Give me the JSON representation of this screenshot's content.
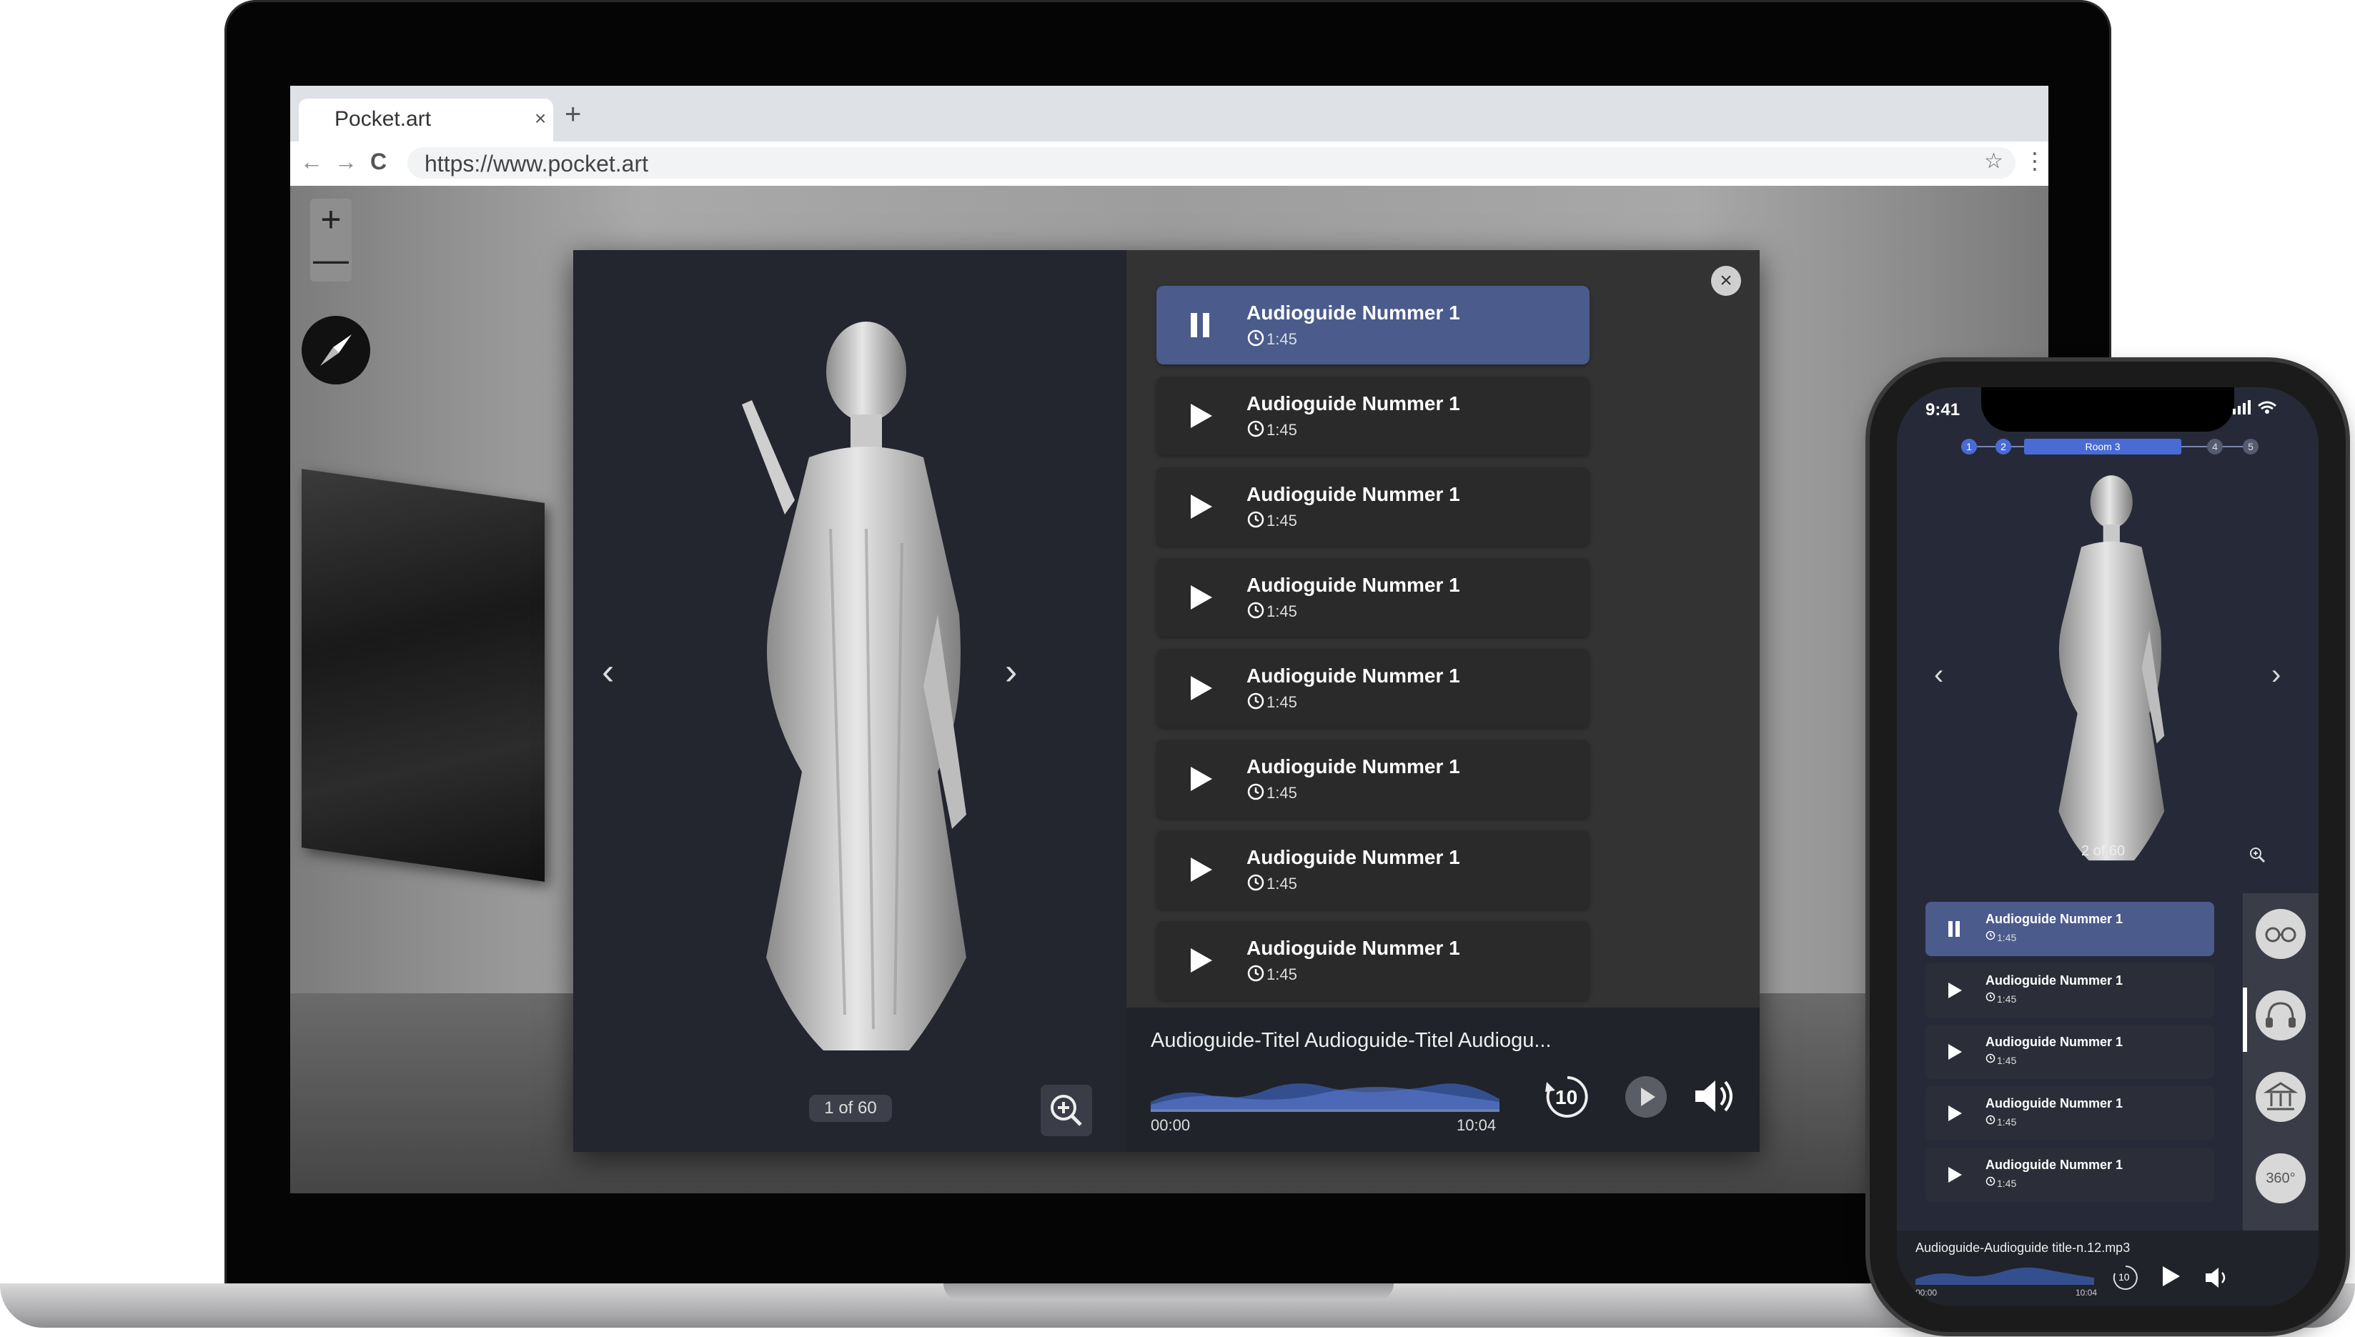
{
  "browser": {
    "tab_title": "Pocket.art",
    "tab_close": "×",
    "new_tab": "+",
    "url": "https://www.pocket.art",
    "back": "←",
    "forward": "→",
    "reload": "C",
    "star": "☆",
    "menu": "⋮"
  },
  "map_controls": {
    "zoom_in": "+",
    "zoom_out": "—"
  },
  "viewer": {
    "counter": "1 of 60",
    "prev": "‹",
    "next": "›"
  },
  "modal": {
    "close": "×"
  },
  "tracks": [
    {
      "title": "Audioguide Nummer 1",
      "duration": "1:45",
      "active": true
    },
    {
      "title": "Audioguide Nummer 1",
      "duration": "1:45",
      "active": false
    },
    {
      "title": "Audioguide Nummer 1",
      "duration": "1:45",
      "active": false
    },
    {
      "title": "Audioguide Nummer 1",
      "duration": "1:45",
      "active": false
    },
    {
      "title": "Audioguide Nummer 1",
      "duration": "1:45",
      "active": false
    },
    {
      "title": "Audioguide Nummer 1",
      "duration": "1:45",
      "active": false
    },
    {
      "title": "Audioguide Nummer 1",
      "duration": "1:45",
      "active": false
    },
    {
      "title": "Audioguide Nummer 1",
      "duration": "1:45",
      "active": false
    }
  ],
  "player": {
    "title": "Audioguide-Titel Audioguide-Titel Audiogu...",
    "time_start": "00:00",
    "time_end": "10:04",
    "skip_label": "10"
  },
  "phone": {
    "time": "9:41",
    "room_label": "Room 3",
    "steps": [
      "1",
      "2",
      "4",
      "5"
    ],
    "counter": "2 of 60",
    "prev": "‹",
    "next": "›",
    "rail_360": "360°",
    "tracks": [
      {
        "title": "Audioguide Nummer 1",
        "duration": "1:45",
        "active": true
      },
      {
        "title": "Audioguide Nummer 1",
        "duration": "1:45",
        "active": false
      },
      {
        "title": "Audioguide Nummer 1",
        "duration": "1:45",
        "active": false
      },
      {
        "title": "Audioguide Nummer 1",
        "duration": "1:45",
        "active": false
      },
      {
        "title": "Audioguide Nummer 1",
        "duration": "1:45",
        "active": false
      }
    ],
    "player": {
      "title": "Audioguide-Audioguide title-n.12.mp3",
      "time_start": "00:00",
      "time_end": "10:04",
      "skip_label": "10"
    }
  },
  "colors": {
    "accent": "#4a5b8c",
    "modal_bg": "#333333",
    "viewer_bg": "#23252f",
    "player_bg": "#202329"
  }
}
